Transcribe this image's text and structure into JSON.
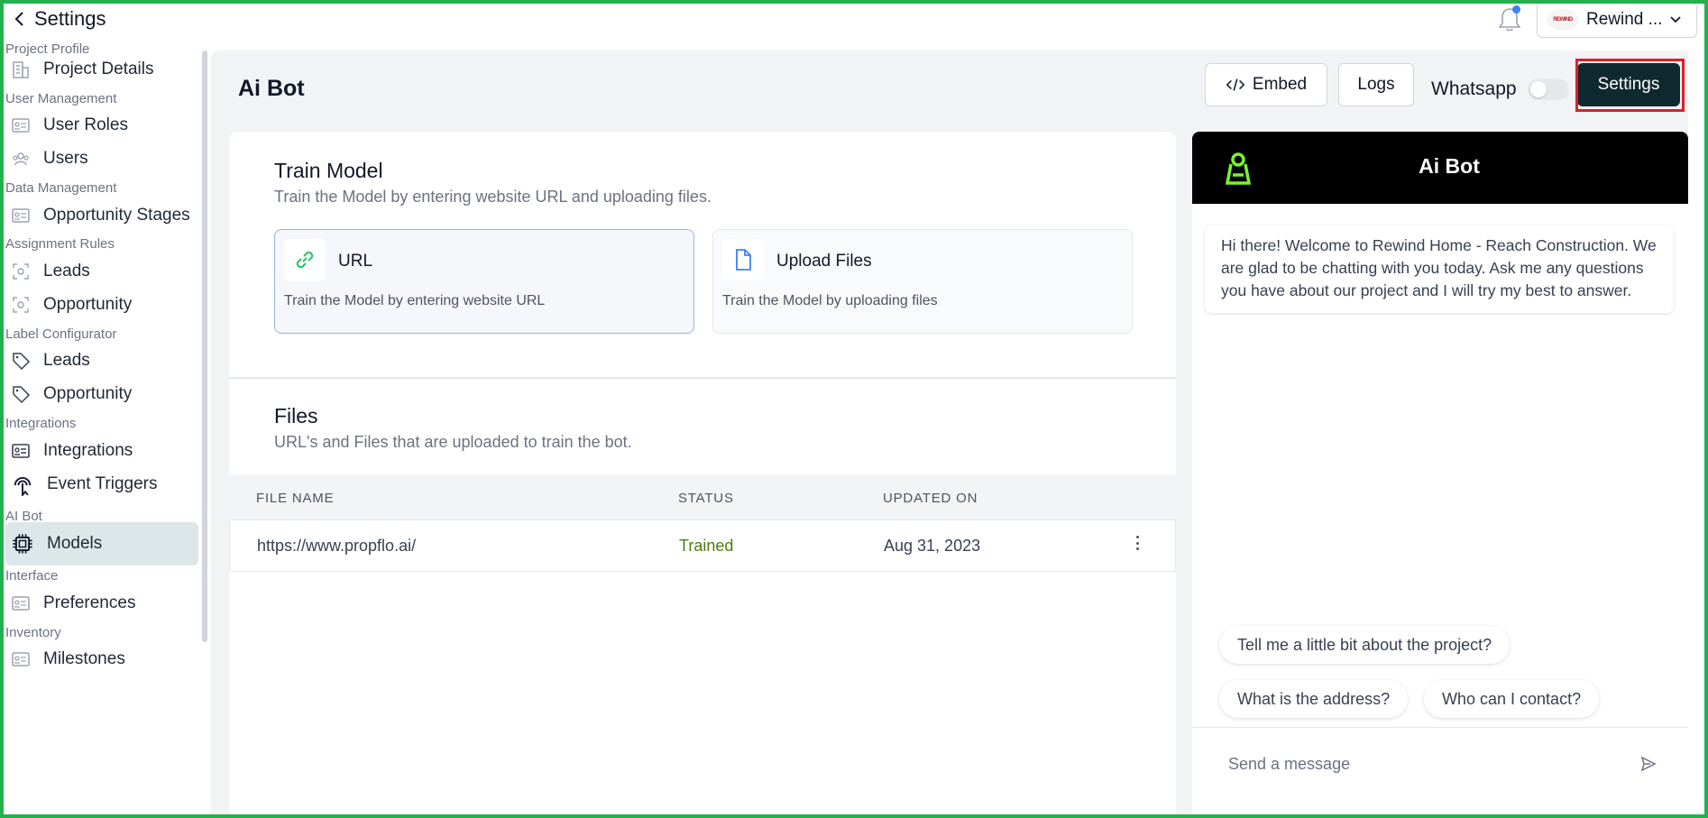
{
  "header": {
    "back_label": "Settings",
    "project_name": "Rewind ...",
    "project_logo_text": "REWIND"
  },
  "sidebar": {
    "sections": [
      {
        "label": "Project Profile",
        "items": [
          {
            "label": "Project Details",
            "icon": "building-icon"
          }
        ]
      },
      {
        "label": "User Management",
        "items": [
          {
            "label": "User Roles",
            "icon": "id-card-icon"
          },
          {
            "label": "Users",
            "icon": "users-icon"
          }
        ]
      },
      {
        "label": "Data Management",
        "items": [
          {
            "label": "Opportunity Stages",
            "icon": "id-card-icon"
          }
        ]
      },
      {
        "label": "Assignment Rules",
        "items": [
          {
            "label": "Leads",
            "icon": "focus-icon"
          },
          {
            "label": "Opportunity",
            "icon": "focus-icon"
          }
        ]
      },
      {
        "label": "Label Configurator",
        "items": [
          {
            "label": "Leads",
            "icon": "tag-icon"
          },
          {
            "label": "Opportunity",
            "icon": "tag-icon"
          }
        ]
      },
      {
        "label": "Integrations",
        "items": [
          {
            "label": "Integrations",
            "icon": "id-card-icon"
          },
          {
            "label": "Event Triggers",
            "icon": "pointer-click-icon"
          }
        ]
      },
      {
        "label": "AI Bot",
        "items": [
          {
            "label": "Models",
            "icon": "chip-icon",
            "active": true
          }
        ]
      },
      {
        "label": "Interface",
        "items": [
          {
            "label": "Preferences",
            "icon": "id-card-icon"
          }
        ]
      },
      {
        "label": "Inventory",
        "items": [
          {
            "label": "Milestones",
            "icon": "id-card-icon"
          }
        ]
      }
    ]
  },
  "main": {
    "title": "Ai Bot",
    "embed_label": "Embed",
    "logs_label": "Logs",
    "whatsapp_label": "Whatsapp",
    "whatsapp_enabled": false,
    "settings_label": "Settings",
    "train": {
      "title": "Train Model",
      "subtitle": "Train the Model by entering website URL and uploading files.",
      "options": [
        {
          "title": "URL",
          "desc": "Train the Model by entering website URL",
          "icon": "link-icon",
          "selected": true
        },
        {
          "title": "Upload Files",
          "desc": "Train the Model by uploading files",
          "icon": "file-icon",
          "selected": false
        }
      ]
    },
    "files": {
      "title": "Files",
      "subtitle": "URL's and Files that are uploaded to train the bot.",
      "columns": [
        "FILE NAME",
        "STATUS",
        "UPDATED ON"
      ],
      "rows": [
        {
          "file_name": "https://www.propflo.ai/",
          "status": "Trained",
          "updated_on": "Aug 31, 2023"
        }
      ]
    }
  },
  "chat": {
    "title": "Ai Bot",
    "welcome": "Hi there! Welcome to Rewind Home - Reach Construction. We are glad to be chatting with you today. Ask me any questions you have about our project and I will try my best to answer.",
    "suggestions": [
      "Tell me a little bit about the project?",
      "What is the address?",
      "Who can I contact?"
    ],
    "input_placeholder": "Send a message"
  },
  "colors": {
    "accent_dark": "#0f2a2f",
    "bot_icon": "#7cf12c",
    "status_trained": "#4d7c0f",
    "active_item_bg": "#dde6e8",
    "highlight_border": "#e11d2a",
    "frame_border": "#22b14c"
  }
}
